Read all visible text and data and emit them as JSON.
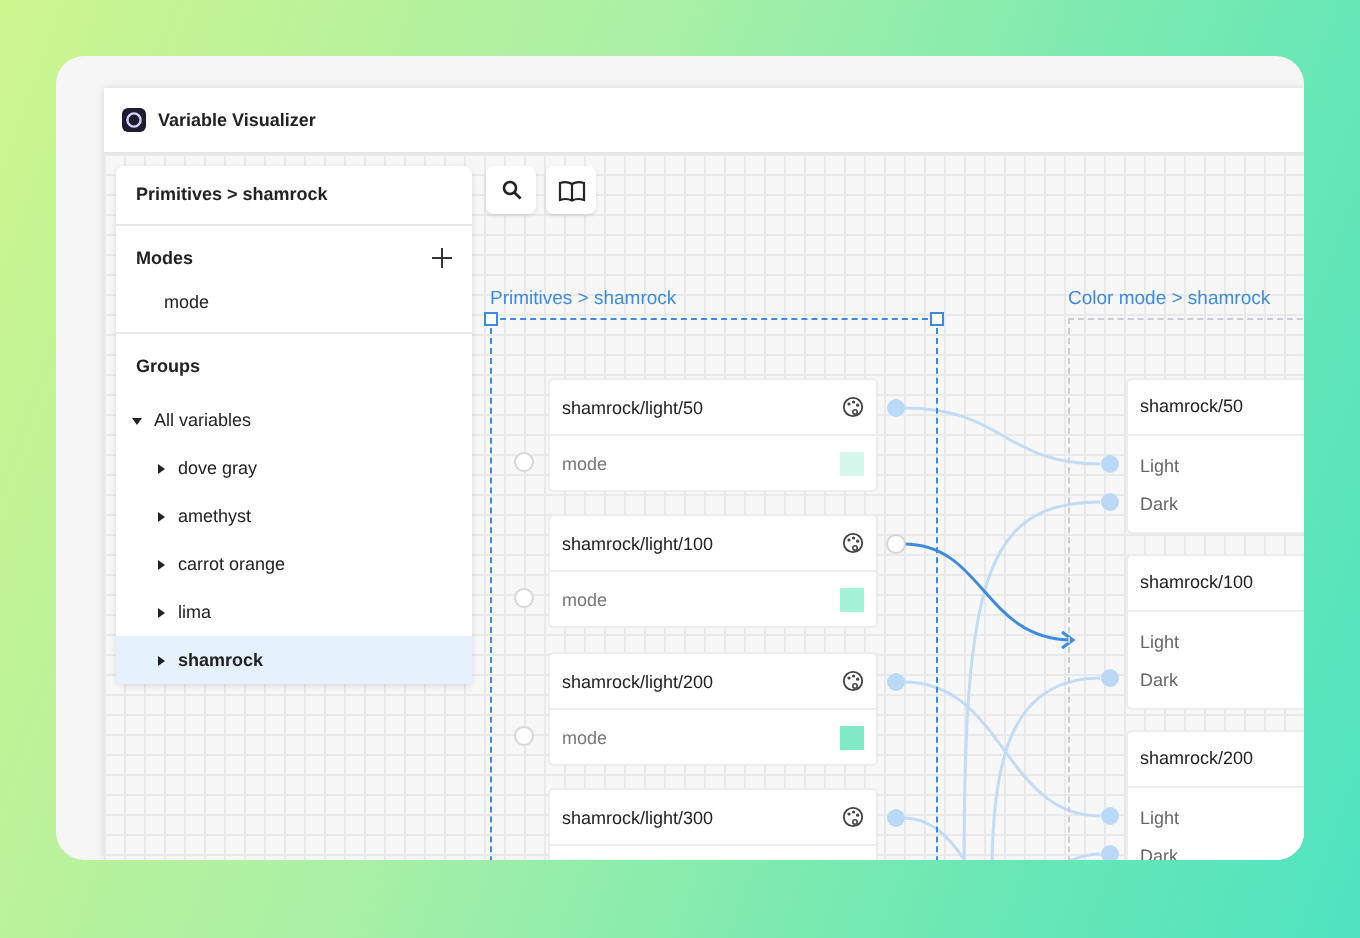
{
  "window": {
    "title": "Variable Visualizer"
  },
  "sidebar": {
    "title": "Primitives > shamrock",
    "modes": {
      "heading": "Modes",
      "items": [
        "mode"
      ]
    },
    "groups": {
      "heading": "Groups",
      "tree": [
        {
          "label": "All variables",
          "expanded": true,
          "selected": false,
          "children": [
            {
              "label": "dove gray",
              "expanded": false,
              "selected": false
            },
            {
              "label": "amethyst",
              "expanded": false,
              "selected": false
            },
            {
              "label": "carrot orange",
              "expanded": false,
              "selected": false
            },
            {
              "label": "lima",
              "expanded": false,
              "selected": false
            },
            {
              "label": "shamrock",
              "expanded": false,
              "selected": true
            }
          ]
        }
      ]
    }
  },
  "canvas": {
    "collections": [
      {
        "title": "Primitives > shamrock",
        "selected": true,
        "variables": [
          {
            "name": "shamrock/light/50",
            "connected": true,
            "modes": [
              {
                "label": "mode",
                "color": "#d6f7eb"
              }
            ]
          },
          {
            "name": "shamrock/light/100",
            "connected": false,
            "modes": [
              {
                "label": "mode",
                "color": "#a4f1d7"
              }
            ]
          },
          {
            "name": "shamrock/light/200",
            "connected": true,
            "modes": [
              {
                "label": "mode",
                "color": "#80eac6"
              }
            ]
          },
          {
            "name": "shamrock/light/300",
            "connected": true
          }
        ]
      },
      {
        "title": "Color mode > shamrock",
        "selected": false,
        "variables": [
          {
            "name": "shamrock/50",
            "modes": [
              {
                "label": "Light",
                "connected": true
              },
              {
                "label": "Dark",
                "connected": true
              }
            ]
          },
          {
            "name": "shamrock/100",
            "modes": [
              {
                "label": "Light",
                "connected": false
              },
              {
                "label": "Dark",
                "connected": true
              }
            ]
          },
          {
            "name": "shamrock/200",
            "modes": [
              {
                "label": "Light",
                "connected": true
              },
              {
                "label": "Dark",
                "connected": true
              }
            ]
          }
        ]
      }
    ]
  }
}
